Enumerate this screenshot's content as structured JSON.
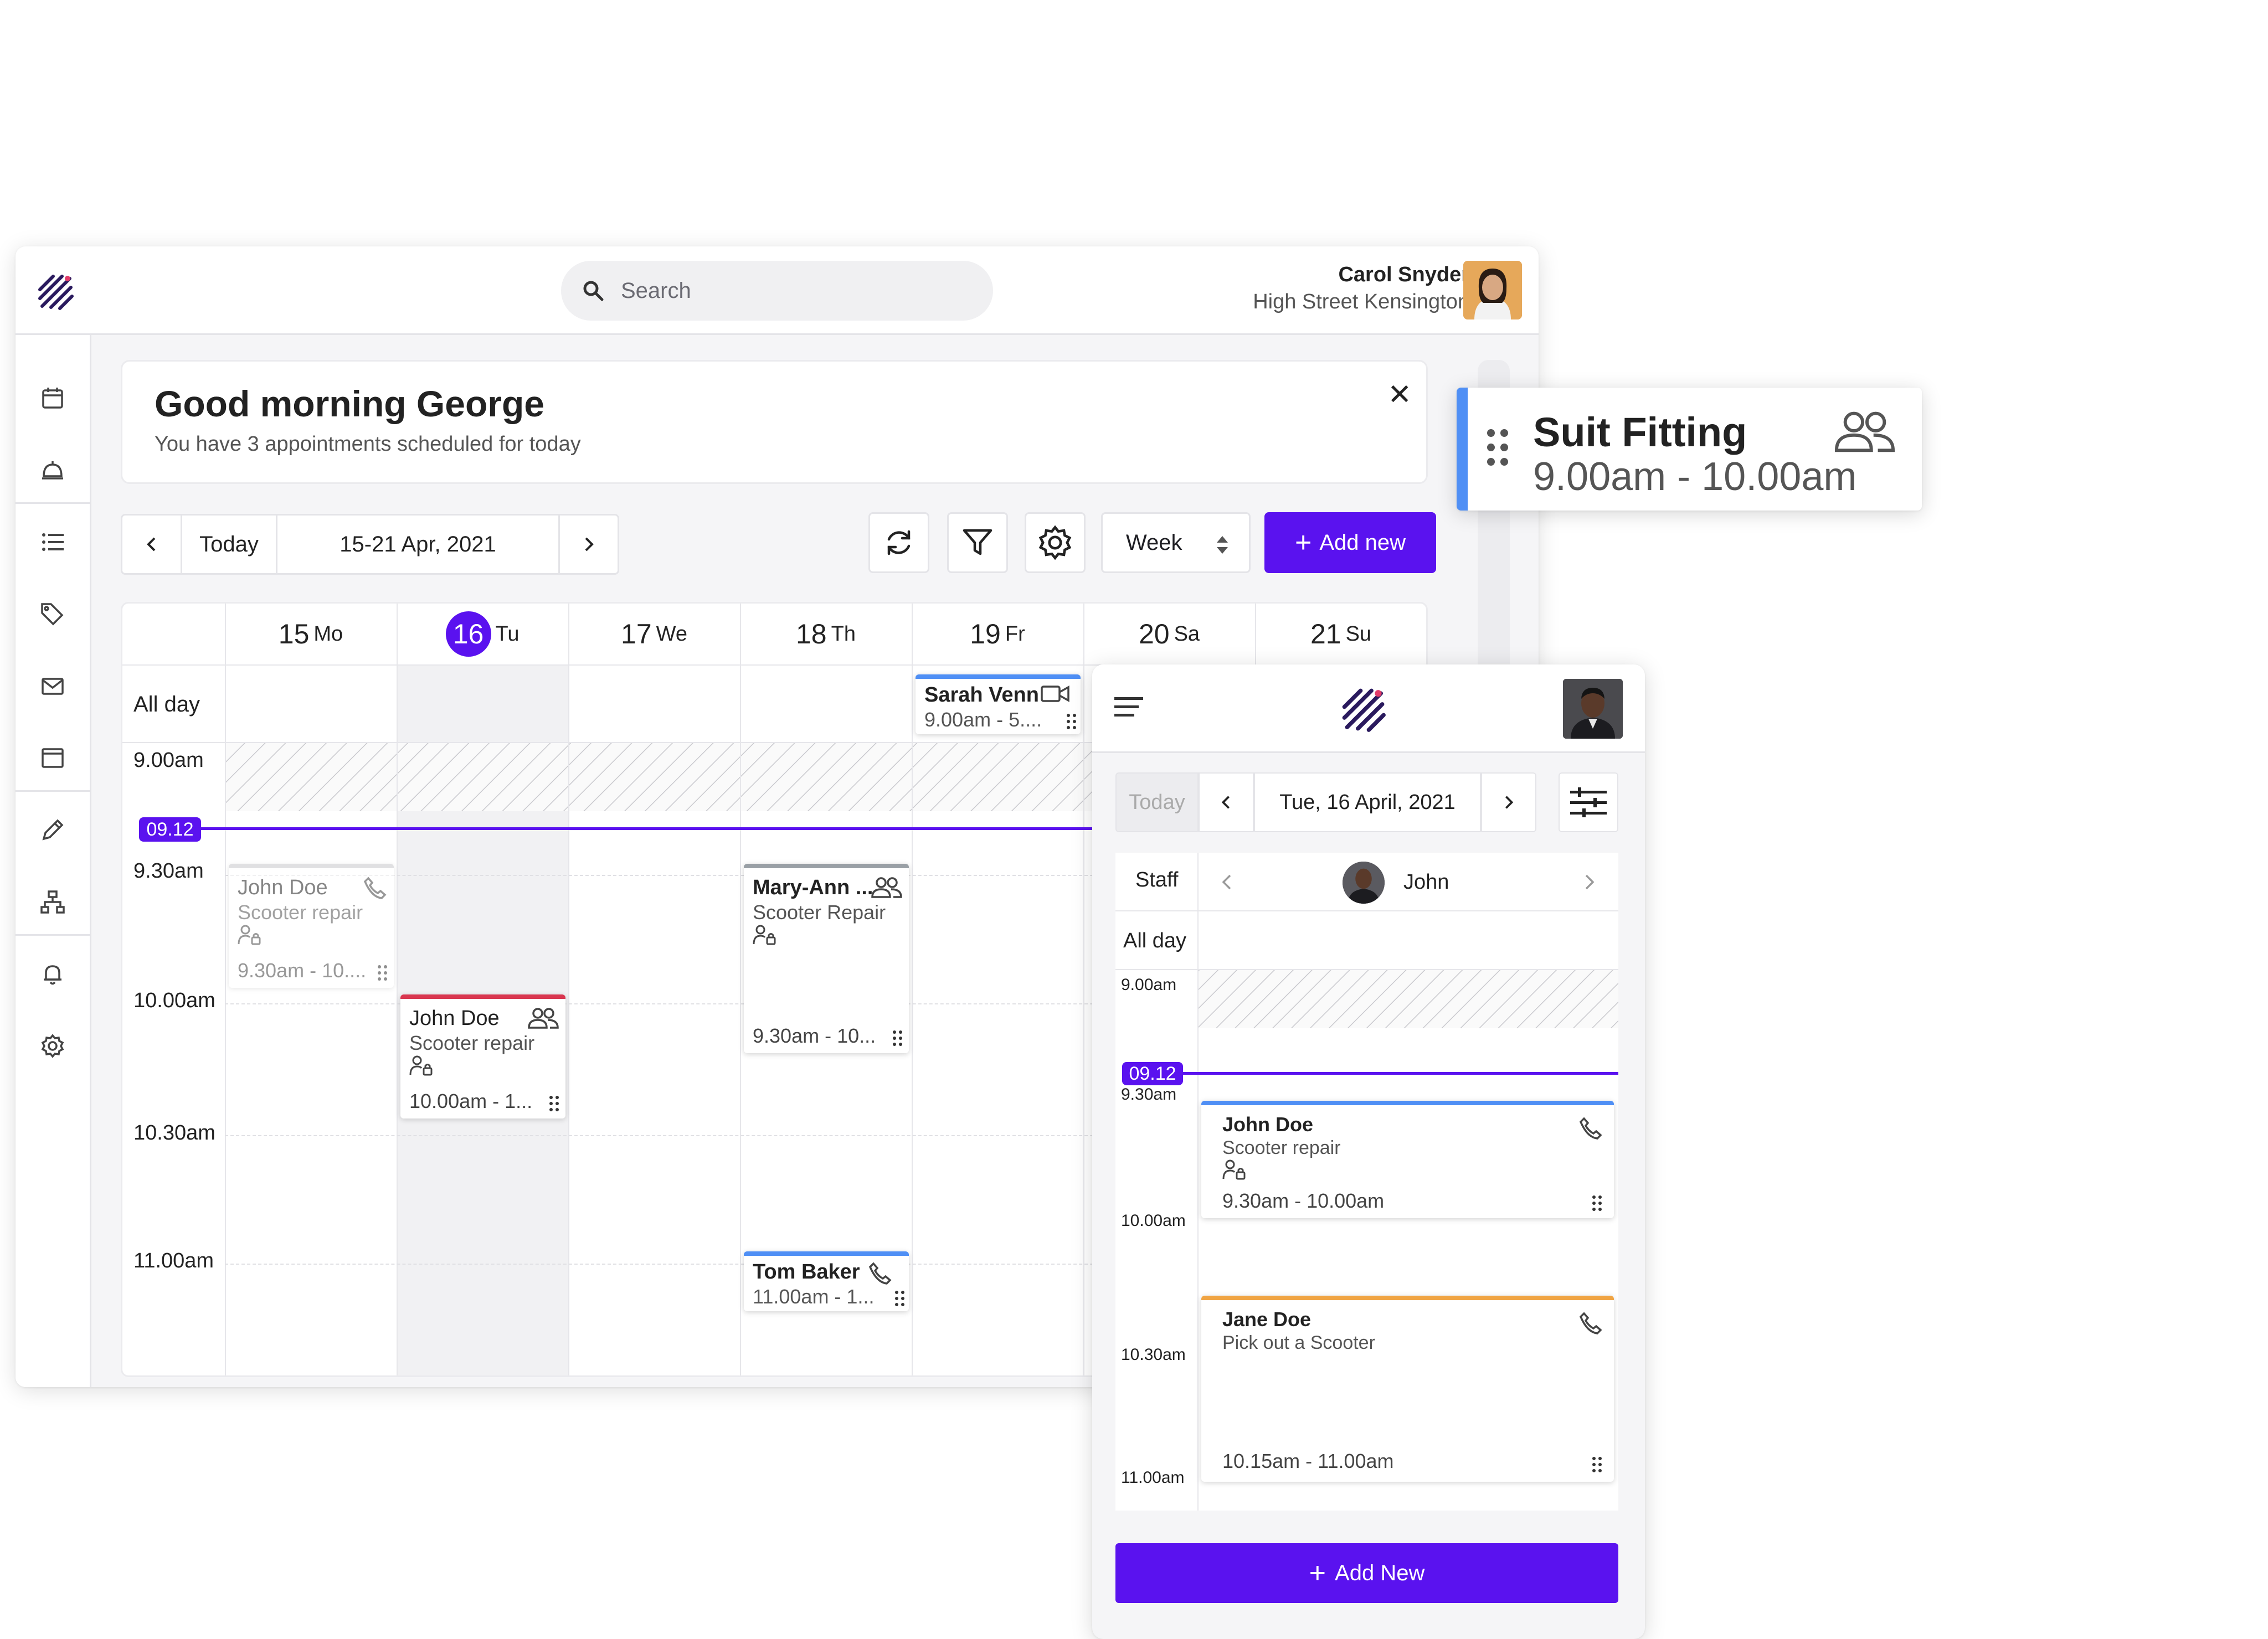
{
  "colors": {
    "accent": "#5a12ef",
    "blue": "#4f8ff5",
    "red": "#d9364f",
    "orange": "#f0a443",
    "grey": "#9aa0a6"
  },
  "desktop": {
    "search_placeholder": "Search",
    "user_name": "Carol Snyder",
    "user_location": "High Street Kensington",
    "welcome_title": "Good morning George",
    "welcome_subtitle": "You have 3 appointments scheduled for today",
    "today_label": "Today",
    "date_range": "15-21 Apr, 2021",
    "view_select": "Week",
    "add_new_label": "Add new",
    "all_day_label": "All day",
    "now_label": "09.12",
    "days": [
      {
        "num": "15",
        "abbr": "Mo"
      },
      {
        "num": "16",
        "abbr": "Tu"
      },
      {
        "num": "17",
        "abbr": "We"
      },
      {
        "num": "18",
        "abbr": "Th"
      },
      {
        "num": "19",
        "abbr": "Fr"
      },
      {
        "num": "20",
        "abbr": "Sa"
      },
      {
        "num": "21",
        "abbr": "Su"
      }
    ],
    "times": [
      "9.00am",
      "9.30am",
      "10.00am",
      "10.30am",
      "11.00am"
    ],
    "events": [
      {
        "name": "Sarah Venn",
        "time": "9.00am - 5....",
        "icon": "video-icon"
      },
      {
        "name": "John Doe",
        "service": "Scooter repair",
        "time": "9.30am - 10....",
        "icon": "phone-icon"
      },
      {
        "name": "John Doe",
        "service": "Scooter repair",
        "time": "10.00am - 1...",
        "icon": "group-icon"
      },
      {
        "name": "Mary-Ann ...",
        "service": "Scooter Repair",
        "time": "9.30am - 10...",
        "icon": "group-icon"
      },
      {
        "name": "Tom Baker",
        "time": "11.00am - 1...",
        "icon": "phone-icon"
      }
    ]
  },
  "suit": {
    "title": "Suit Fitting",
    "time": "9.00am - 10.00am"
  },
  "mobile": {
    "today_label": "Today",
    "date": "Tue, 16 April, 2021",
    "staff_label": "Staff",
    "staff_name": "John",
    "all_day_label": "All day",
    "now_label": "09.12",
    "times": [
      "9.00am",
      "9.30am",
      "10.00am",
      "10.30am",
      "11.00am"
    ],
    "events": [
      {
        "name": "John Doe",
        "service": "Scooter repair",
        "time": "9.30am - 10.00am"
      },
      {
        "name": "Jane Doe",
        "service": "Pick out a Scooter",
        "time": "10.15am - 11.00am"
      }
    ],
    "add_new_label": "Add New"
  }
}
